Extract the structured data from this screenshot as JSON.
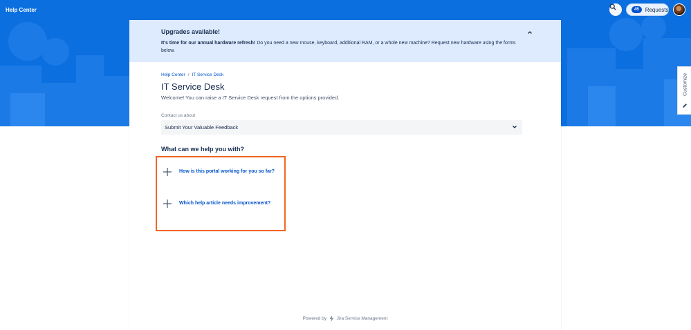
{
  "header": {
    "title": "Help Center",
    "requests_count": "45",
    "requests_label": "Requests"
  },
  "customize": {
    "label": "Customize"
  },
  "banner": {
    "title": "Upgrades available!",
    "body_bold": "It's time for our annual hardware refresh!",
    "body_rest": " Do you need a new mouse, keyboard, additional RAM, or a whole new machine? Request new hardware using the forms below."
  },
  "breadcrumb": {
    "home": "Help Center",
    "separator": "/",
    "current": "IT Service Desk"
  },
  "page": {
    "title": "IT Service Desk",
    "welcome": "Welcome! You can raise a IT Service Desk request from the options provided."
  },
  "contact": {
    "label": "Contact us about",
    "selected": "Submit Your Valuable Feedback"
  },
  "help": {
    "heading": "What can we help you with?",
    "options": [
      {
        "label": "How is this portal working for you so far?"
      },
      {
        "label": "Which help article needs improvement?"
      }
    ]
  },
  "footer": {
    "powered_by": "Powered by",
    "product": "Jira Service Management"
  },
  "colors": {
    "brand_blue": "#0b6fe0",
    "link_blue": "#0052cc",
    "banner_bg": "#deebff",
    "highlight_orange": "#f26522"
  },
  "icons": [
    "search-icon",
    "chevron-up-icon",
    "chevron-down-icon",
    "plus-icon",
    "pencil-icon",
    "jira-logo-icon"
  ]
}
